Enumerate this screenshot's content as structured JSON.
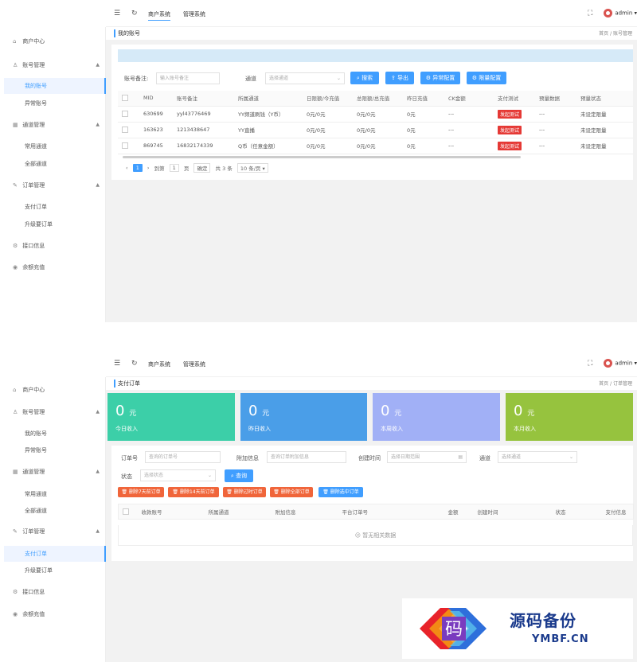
{
  "topbar": {
    "menus": [
      "商户系统",
      "管理系统"
    ],
    "user": "admin ▾",
    "menu_icon": "hamburger-icon",
    "refresh_icon": "refresh-icon",
    "fullscreen_icon": "fullscreen-icon"
  },
  "sidebar": {
    "home": "商户中心",
    "groups": [
      {
        "label": "账号管理",
        "items": [
          "我的账号",
          "异常账号"
        ]
      },
      {
        "label": "通道管理",
        "items": [
          "常用通道",
          "全部通道"
        ]
      },
      {
        "label": "订单管理",
        "items": [
          "支付订单",
          "升级要订单"
        ]
      }
    ],
    "extra": [
      "接口信息",
      "余额充值"
    ]
  },
  "screen1": {
    "page_title": "我的账号",
    "breadcrumb": "首页 / 账号管理",
    "filter_label": "账号备注:",
    "filter_placeholder": "输入账号备注",
    "channel_label": "通道",
    "channel_placeholder": "选择通道",
    "buttons": {
      "search": "搜索",
      "export": "导出",
      "abnormal": "异常配置",
      "limit": "限量配置"
    },
    "columns": [
      "MID",
      "账号备注",
      "所属通道",
      "日限额/今充值",
      "总限额/总充值",
      "昨日充值",
      "CK金额",
      "支付测试",
      "预量数据",
      "预量状态"
    ],
    "rows": [
      {
        "mid": "630699",
        "remark": "yyl43776469",
        "channel": "YY频道刷钱（Y币）",
        "daily": "0元/0元",
        "total": "0元/0元",
        "yesterday": "0元",
        "ck": "---",
        "test": "发起测试",
        "pre": "---",
        "status": "未设定限量"
      },
      {
        "mid": "163623",
        "remark": "1213438647",
        "channel": "YY直播",
        "daily": "0元/0元",
        "total": "0元/0元",
        "yesterday": "0元",
        "ck": "---",
        "test": "发起测试",
        "pre": "---",
        "status": "未设定限量"
      },
      {
        "mid": "869745",
        "remark": "16832174339",
        "channel": "Q币（任意金额）",
        "daily": "0元/0元",
        "total": "0元/0元",
        "yesterday": "0元",
        "ck": "---",
        "test": "发起测试",
        "pre": "---",
        "status": "未设定限量"
      }
    ],
    "pager": {
      "current": "1",
      "goto_label": "到第",
      "page_input": "1",
      "page_unit": "页",
      "confirm": "确定",
      "total": "共 3 条",
      "size": "10 条/页 ▾"
    }
  },
  "screen2": {
    "page_title": "支付订单",
    "breadcrumb": "首页 / 订单管理",
    "stats": [
      {
        "value": "0",
        "unit": "元",
        "label": "今日收入",
        "color": "#3ccfa8"
      },
      {
        "value": "0",
        "unit": "元",
        "label": "昨日收入",
        "color": "#4a9ee8"
      },
      {
        "value": "0",
        "unit": "元",
        "label": "本周收入",
        "color": "#a1b0f6"
      },
      {
        "value": "0",
        "unit": "元",
        "label": "本月收入",
        "color": "#96c33e"
      }
    ],
    "filters": {
      "order_label": "订单号",
      "order_placeholder": "查询的订单号",
      "attach_label": "附加信息",
      "attach_placeholder": "查询订单附加信息",
      "time_label": "创建时间",
      "time_placeholder": "选择日期范围",
      "channel_label": "通道",
      "channel_placeholder": "选择通道",
      "status_label": "状态",
      "status_placeholder": "选择状态",
      "query": "查询"
    },
    "actions": [
      "删除7天前订单",
      "删除14天前订单",
      "删除过时订单",
      "删除全部订单",
      "删除选中订单"
    ],
    "columns": [
      "收款账号",
      "所属通道",
      "附加信息",
      "平台订单号",
      "金额",
      "创建时间",
      "状态",
      "支付信息"
    ],
    "empty": "暂无相关数据"
  },
  "watermark": {
    "title": "源码备份",
    "sub": "YMBF.CN",
    "glyph": "码"
  }
}
